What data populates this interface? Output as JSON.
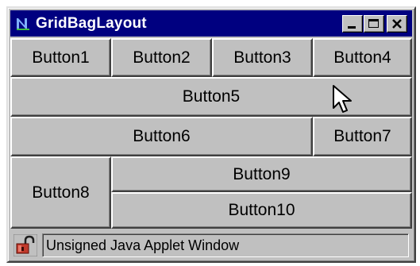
{
  "window": {
    "title": "GridBagLayout"
  },
  "titlebar_buttons": {
    "minimize_icon": "minimize-icon",
    "maximize_icon": "maximize-icon",
    "close_icon": "close-icon"
  },
  "buttons": {
    "b1": "Button1",
    "b2": "Button2",
    "b3": "Button3",
    "b4": "Button4",
    "b5": "Button5",
    "b6": "Button6",
    "b7": "Button7",
    "b8": "Button8",
    "b9": "Button9",
    "b10": "Button10"
  },
  "statusbar": {
    "text": "Unsigned Java Applet Window",
    "icon": "unlocked-padlock-icon"
  },
  "colors": {
    "titlebar": "#000080",
    "face": "#c0c0c0"
  }
}
